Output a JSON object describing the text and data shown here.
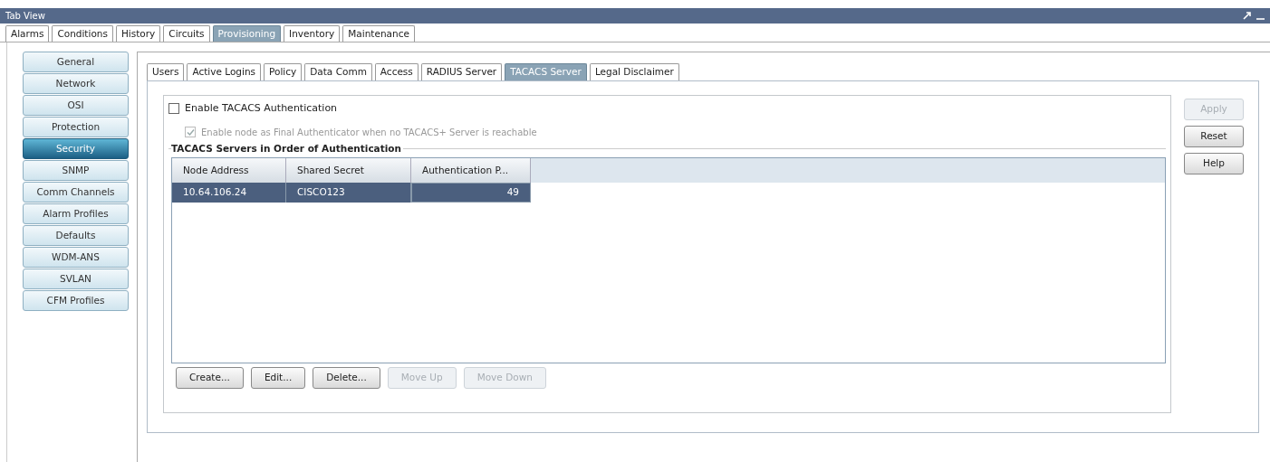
{
  "window": {
    "title": "Tab View"
  },
  "tabs": [
    {
      "label": "Alarms",
      "selected": false
    },
    {
      "label": "Conditions",
      "selected": false
    },
    {
      "label": "History",
      "selected": false
    },
    {
      "label": "Circuits",
      "selected": false
    },
    {
      "label": "Provisioning",
      "selected": true
    },
    {
      "label": "Inventory",
      "selected": false
    },
    {
      "label": "Maintenance",
      "selected": false
    }
  ],
  "sidebar": {
    "items": [
      {
        "label": "General",
        "selected": false
      },
      {
        "label": "Network",
        "selected": false
      },
      {
        "label": "OSI",
        "selected": false
      },
      {
        "label": "Protection",
        "selected": false
      },
      {
        "label": "Security",
        "selected": true
      },
      {
        "label": "SNMP",
        "selected": false
      },
      {
        "label": "Comm Channels",
        "selected": false
      },
      {
        "label": "Alarm Profiles",
        "selected": false
      },
      {
        "label": "Defaults",
        "selected": false
      },
      {
        "label": "WDM-ANS",
        "selected": false
      },
      {
        "label": "SVLAN",
        "selected": false
      },
      {
        "label": "CFM Profiles",
        "selected": false
      }
    ]
  },
  "subtabs": [
    {
      "label": "Users",
      "selected": false
    },
    {
      "label": "Active Logins",
      "selected": false
    },
    {
      "label": "Policy",
      "selected": false
    },
    {
      "label": "Data Comm",
      "selected": false
    },
    {
      "label": "Access",
      "selected": false
    },
    {
      "label": "RADIUS Server",
      "selected": false
    },
    {
      "label": "TACACS Server",
      "selected": true
    },
    {
      "label": "Legal Disclaimer",
      "selected": false
    }
  ],
  "options": [
    {
      "label": "Enable TACACS Authentication",
      "checked": false,
      "disabled": false
    },
    {
      "label": "Enable node as Final Authenticator when no TACACS+ Server is reachable",
      "checked": true,
      "disabled": true
    }
  ],
  "group_title": "TACACS Servers in Order of Authentication",
  "table": {
    "columns": [
      "Node Address",
      "Shared Secret",
      "Authentication P..."
    ],
    "rows": [
      {
        "cells": [
          "10.64.106.24",
          "CISCO123",
          "49"
        ],
        "selected": true
      }
    ]
  },
  "table_buttons": [
    {
      "label": "Create...",
      "disabled": false
    },
    {
      "label": "Edit...",
      "disabled": false
    },
    {
      "label": "Delete...",
      "disabled": false
    },
    {
      "label": "Move Up",
      "disabled": true
    },
    {
      "label": "Move Down",
      "disabled": true
    }
  ],
  "side_buttons": [
    {
      "label": "Apply",
      "disabled": true
    },
    {
      "label": "Reset",
      "disabled": false
    },
    {
      "label": "Help",
      "disabled": false
    }
  ]
}
